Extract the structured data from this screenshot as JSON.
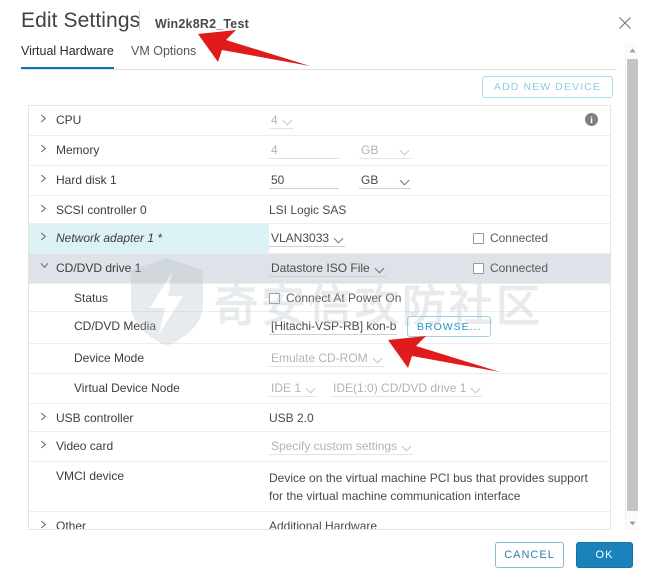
{
  "window": {
    "title": "Edit Settings",
    "vm_name": "Win2k8R2_Test",
    "close_icon": "close-icon"
  },
  "tabs": [
    {
      "label": "Virtual Hardware",
      "active": true
    },
    {
      "label": "VM Options",
      "active": false
    }
  ],
  "toolbar": {
    "add_new_device_label": "ADD NEW DEVICE"
  },
  "colors": {
    "accent": "#0079b8",
    "primary_button": "#1b82bb",
    "row_highlight_cyan": "#ddf2f5",
    "row_highlight_gray": "#dde3e8",
    "arrow_red": "#e01b1b"
  },
  "hardware_rows": [
    {
      "id": "cpu",
      "label": "CPU",
      "expandable": true,
      "expanded": false,
      "value_type": "select",
      "value": "4",
      "dim": true,
      "info_icon": true
    },
    {
      "id": "memory",
      "label": "Memory",
      "expandable": true,
      "expanded": false,
      "value_type": "number-unit",
      "value": "4",
      "unit": "GB",
      "dim": true
    },
    {
      "id": "hard-disk-1",
      "label": "Hard disk 1",
      "expandable": true,
      "expanded": false,
      "value_type": "number-unit",
      "value": "50",
      "unit": "GB",
      "dim": false
    },
    {
      "id": "scsi-controller-0",
      "label": "SCSI controller 0",
      "expandable": true,
      "expanded": false,
      "value_type": "text",
      "value": "LSI Logic SAS",
      "dim": false
    },
    {
      "id": "network-adapter-1",
      "label": "Network adapter 1 *",
      "expandable": true,
      "expanded": false,
      "italic": true,
      "highlight": "cyan",
      "value_type": "select",
      "value": "VLAN3033",
      "dim": false,
      "checkbox": {
        "label": "Connected",
        "checked": false,
        "dim": false
      }
    },
    {
      "id": "cd-dvd-drive-1",
      "label": "CD/DVD drive 1",
      "expandable": true,
      "expanded": true,
      "highlight": "gray",
      "value_type": "select",
      "value": "Datastore ISO File",
      "dim": false,
      "checkbox": {
        "label": "Connected",
        "checked": false,
        "dim": false
      }
    },
    {
      "id": "status",
      "label": "Status",
      "sub": true,
      "value_type": "checkbox",
      "checkbox": {
        "label": "Connect At Power On",
        "checked": false,
        "dim": false
      }
    },
    {
      "id": "cd-dvd-media",
      "label": "CD/DVD Media",
      "sub": true,
      "value_type": "path-browse",
      "value": "[Hitachi-VSP-RB] kon-bo",
      "browse_label": "BROWSE..."
    },
    {
      "id": "device-mode",
      "label": "Device Mode",
      "sub": true,
      "value_type": "select",
      "value": "Emulate CD-ROM",
      "dim": true
    },
    {
      "id": "virtual-device-node",
      "label": "Virtual Device Node",
      "sub": true,
      "value_type": "double-select",
      "value": "IDE 1",
      "value2": "IDE(1:0) CD/DVD drive 1",
      "dim": true
    },
    {
      "id": "usb-controller",
      "label": "USB controller",
      "expandable": true,
      "expanded": false,
      "value_type": "text",
      "value": "USB 2.0",
      "dim": false
    },
    {
      "id": "video-card",
      "label": "Video card",
      "expandable": true,
      "expanded": false,
      "value_type": "select",
      "value": "Specify custom settings",
      "dim": true
    },
    {
      "id": "vmci-device",
      "label": "VMCI device",
      "sub": false,
      "indent_label": true,
      "value_type": "multiline",
      "value": "Device on the virtual machine PCI bus that provides support for the virtual machine communication interface",
      "dim": false
    },
    {
      "id": "other",
      "label": "Other",
      "expandable": true,
      "expanded": false,
      "value_type": "text",
      "value": "Additional Hardware",
      "dim": false
    }
  ],
  "scrollbar": {
    "up_icon": "chevron-up-icon",
    "down_icon": "chevron-down-icon"
  },
  "footer": {
    "cancel_label": "CANCEL",
    "ok_label": "OK"
  },
  "watermark": {
    "text": "奇安信攻防社区",
    "logo_icon": "shield-lightning-icon"
  },
  "annotations": [
    {
      "id": "arrow-title",
      "icon": "arrow-up-left-icon",
      "points_at": "Win2k8R2_Test"
    },
    {
      "id": "arrow-media",
      "icon": "arrow-up-left-icon",
      "points_at": "[Hitachi-VSP-RB] kon-bo"
    }
  ]
}
